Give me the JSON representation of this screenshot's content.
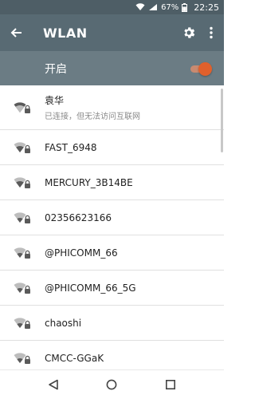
{
  "status_bar": {
    "battery": "67%",
    "time": "22:25"
  },
  "app_bar": {
    "title": "WLAN",
    "back_icon": "arrow-left-icon",
    "settings_icon": "gear-icon",
    "more_icon": "more-vert-icon"
  },
  "toggle": {
    "label": "开启",
    "state": "on",
    "accent_color": "#e0602c"
  },
  "networks": [
    {
      "ssid": "袁华",
      "status": "已连接，但无法访问互联网",
      "secured": true
    },
    {
      "ssid": "FAST_6948",
      "status": "",
      "secured": true
    },
    {
      "ssid": "MERCURY_3B14BE",
      "status": "",
      "secured": true
    },
    {
      "ssid": "02356623166",
      "status": "",
      "secured": true
    },
    {
      "ssid": "@PHICOMM_66",
      "status": "",
      "secured": true
    },
    {
      "ssid": "@PHICOMM_66_5G",
      "status": "",
      "secured": true
    },
    {
      "ssid": "chaoshi",
      "status": "",
      "secured": true
    },
    {
      "ssid": "CMCC-GGaK",
      "status": "",
      "secured": true
    }
  ],
  "nav_bar": {
    "back_icon": "triangle-back-icon",
    "home_icon": "circle-home-icon",
    "recents_icon": "square-recents-icon"
  }
}
